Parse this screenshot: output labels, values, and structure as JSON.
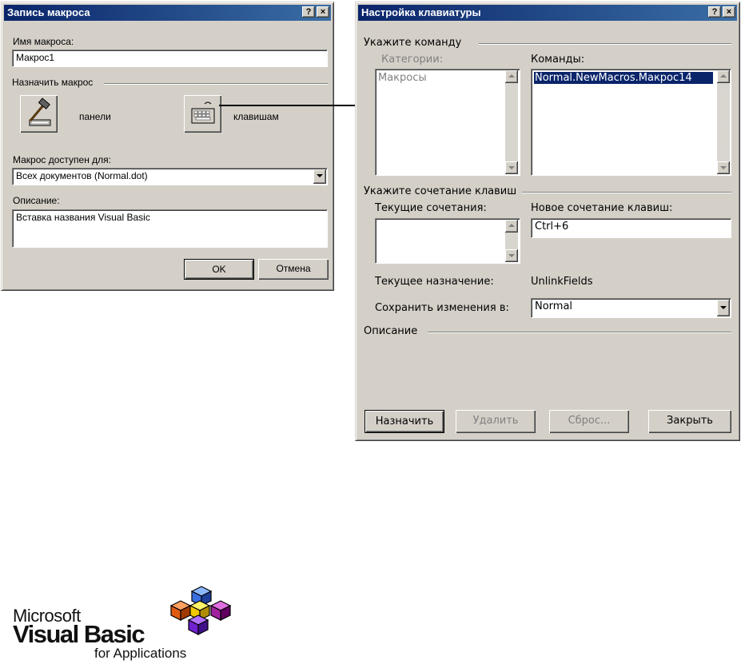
{
  "macro_dialog": {
    "title": "Запись макроса",
    "help_button": "?",
    "close_button": "×",
    "name_label": "Имя макроса:",
    "name_value": "Макрос1",
    "assign_group": "Назначить макрос",
    "toolbar_label": "панели",
    "keyboard_label": "клавишам",
    "available_label": "Макрос доступен для:",
    "available_value": "Всех документов (Normal.dot)",
    "description_label": "Описание:",
    "description_value": "Вставка названия Visual Basic",
    "ok_label": "OK",
    "cancel_label": "Отмена"
  },
  "keyboard_dialog": {
    "title": "Настройка клавиатуры",
    "help_button": "?",
    "close_button": "×",
    "command_group": "Укажите команду",
    "categories_label": "Категории:",
    "categories_items": [
      "Макросы"
    ],
    "commands_label": "Команды:",
    "commands_items": [
      "Normal.NewMacros.Макрос14"
    ],
    "shortcut_group": "Укажите сочетание клавиш",
    "current_keys_label": "Текущие сочетания:",
    "new_key_label": "Новое сочетание клавиш:",
    "new_key_value": "Ctrl+6",
    "current_assignment_label": "Текущее назначение:",
    "current_assignment_value": "UnlinkFields",
    "save_in_label": "Сохранить изменения в:",
    "save_in_value": "Normal",
    "description_group": "Описание",
    "assign_button": "Назначить",
    "remove_button": "Удалить",
    "reset_button": "Сброс...",
    "close_label": "Закрыть"
  },
  "logo": {
    "line1": "Microsoft",
    "line2": "Visual Basic",
    "line3": "for Applications"
  },
  "colors": {
    "title_bar": "#0a246a",
    "selection": "#0a246a",
    "dialog_face": "#d4d0c8"
  }
}
